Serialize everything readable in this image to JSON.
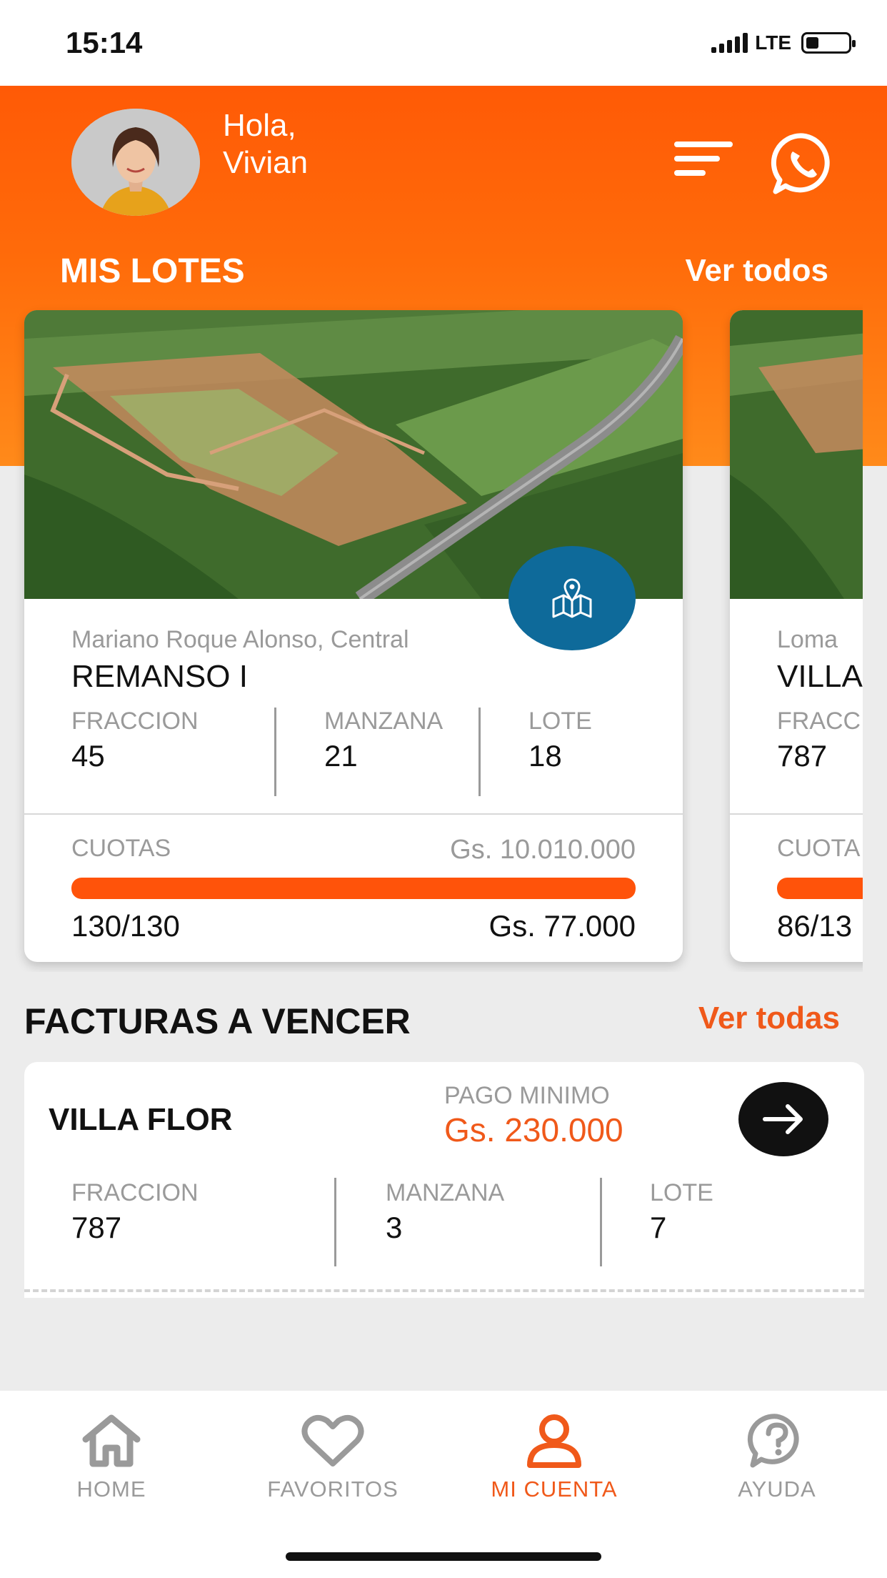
{
  "status_bar": {
    "time": "15:14",
    "network": "LTE",
    "battery_fraction": 0.3
  },
  "header": {
    "greeting_line1": "Hola,",
    "greeting_line2": "Vivian"
  },
  "lots_section": {
    "title": "MIS LOTES",
    "see_all": "Ver todos",
    "cards": [
      {
        "location": "Mariano Roque Alonso, Central",
        "name": "REMANSO I",
        "labels": {
          "fraccion": "FRACCION",
          "manzana": "MANZANA",
          "lote": "LOTE",
          "cuotas": "CUOTAS"
        },
        "fraccion": "45",
        "manzana": "21",
        "lote": "18",
        "cuotas_total": "Gs. 10.010.000",
        "cuotas_count": "130/130",
        "cuota_amount": "Gs. 77.000",
        "progress_fraction": 1.0
      },
      {
        "location": "Loma",
        "name": "VILLA",
        "labels": {
          "fraccion": "FRACC",
          "cuotas": "CUOTA"
        },
        "fraccion": "787",
        "cuotas_count": "86/13",
        "progress_fraction": 0.66
      }
    ]
  },
  "invoices_section": {
    "title": "FACTURAS A VENCER",
    "see_all": "Ver todas",
    "invoice": {
      "name": "VILLA FLOR",
      "min_payment_label": "PAGO MINIMO",
      "min_payment": "Gs. 230.000",
      "labels": {
        "fraccion": "FRACCION",
        "manzana": "MANZANA",
        "lote": "LOTE"
      },
      "fraccion": "787",
      "manzana": "3",
      "lote": "7"
    }
  },
  "tab_bar": {
    "tabs": [
      {
        "label": "HOME",
        "icon": "home-icon"
      },
      {
        "label": "FAVORITOS",
        "icon": "heart-icon"
      },
      {
        "label": "MI CUENTA",
        "icon": "user-icon",
        "active": true
      },
      {
        "label": "AYUDA",
        "icon": "help-icon"
      }
    ]
  },
  "colors": {
    "brand_orange": "#ff5a06",
    "accent_text": "#f0591a",
    "map_button": "#0e6a9a"
  }
}
